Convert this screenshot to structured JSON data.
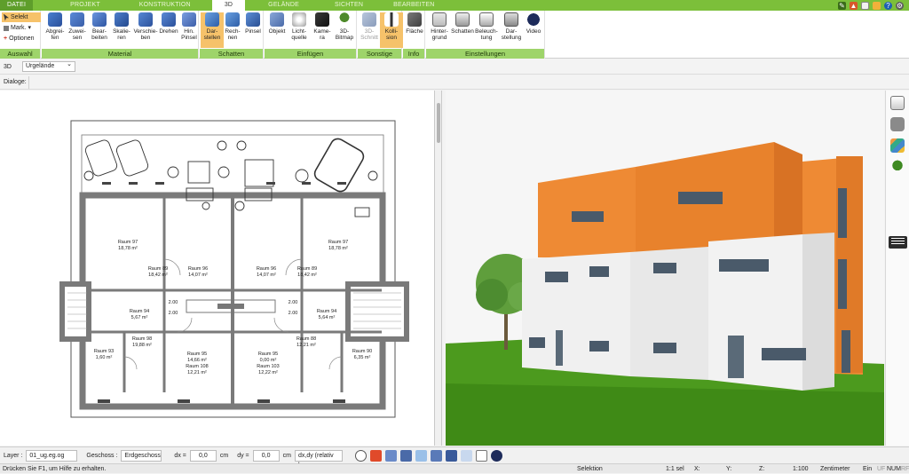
{
  "tabs": [
    {
      "label": "DATEI"
    },
    {
      "label": "PROJEKT"
    },
    {
      "label": "KONSTRUKTION"
    },
    {
      "label": "3D"
    },
    {
      "label": "GELÄNDE"
    },
    {
      "label": "SICHTEN"
    },
    {
      "label": "BEARBEITEN"
    }
  ],
  "active_tab": "3D",
  "ribbon": {
    "auswahl": {
      "caption": "Auswahl",
      "selekt": "Selekt",
      "mark": "Mark.",
      "optionen": "Optionen"
    },
    "material": {
      "caption": "Material",
      "buttons": [
        "Abgrei-\nfen",
        "Zuwei-\nsen",
        "Bear-\nbeiten",
        "Skalie-\nren",
        "Verschie-\nben",
        "Drehen",
        "Hin.\nPinsel"
      ]
    },
    "schatten": {
      "caption": "Schatten",
      "buttons": [
        "Dar-\nstellen",
        "Rech-\nnen",
        "Pinsel"
      ]
    },
    "einfuegen": {
      "caption": "Einfügen",
      "buttons": [
        "Objekt",
        "Licht-\nquelle",
        "Kame-\nra",
        "3D-\nBitmap"
      ]
    },
    "sonstige": {
      "caption": "Sonstige",
      "buttons": [
        "3D-\nSchnitt",
        "Kolli-\nsion"
      ]
    },
    "info": {
      "caption": "Info",
      "buttons": [
        "Fläche"
      ]
    },
    "einstellungen": {
      "caption": "Einstellungen",
      "buttons": [
        "Hinter-\ngrund",
        "Schatten",
        "Beleuch-\ntung",
        "Dar-\nstellung",
        "Video"
      ]
    }
  },
  "viewbar": {
    "mode": "3D",
    "terrain": "Urgelände"
  },
  "dialoge_label": "Dialoge:",
  "plan": {
    "rooms": [
      {
        "name": "Raum 97",
        "area": "18,78 m²"
      },
      {
        "name": "Raum 97",
        "area": "18,78 m²"
      },
      {
        "name": "Raum 96",
        "area": "14,07 m²"
      },
      {
        "name": "Raum 96",
        "area": "14,07 m²"
      },
      {
        "name": "Raum 89",
        "area": "18,42 m²"
      },
      {
        "name": "Raum 89",
        "area": "18,42 m²"
      },
      {
        "name": "Raum 94",
        "area": "5,67 m²"
      },
      {
        "name": "Raum 94",
        "area": "5,64 m²"
      },
      {
        "name": "Raum 95",
        "area": "14,66 m²"
      },
      {
        "name": "Raum 95",
        "area": "0,00 m²"
      },
      {
        "name": "Raum 108",
        "area": "12,21 m²"
      },
      {
        "name": "Raum 103",
        "area": "12,22 m²"
      },
      {
        "name": "Raum 93",
        "area": "1,60 m²"
      },
      {
        "name": "Raum 90",
        "area": "6,35 m²"
      },
      {
        "name": "Raum 98",
        "area": "19,88 m²"
      },
      {
        "name": "Raum 88",
        "area": "12,21 m²"
      }
    ],
    "dims": [
      "2.00",
      "2.00",
      "2.00",
      "2.00"
    ]
  },
  "inputbar": {
    "layer_label": "Layer :",
    "layer_value": "01_ug.eg.og",
    "geschoss_label": "Geschoss :",
    "geschoss_value": "Erdgeschoss",
    "dx_label": "dx =",
    "dx_value": "0,0",
    "dx_unit": "cm",
    "dy_label": "dy =",
    "dy_value": "0,0",
    "dy_unit": "cm",
    "mode_value": "dx,dy (relativ ka"
  },
  "statusbar": {
    "hint": "Drücken Sie F1, um Hilfe zu erhalten.",
    "mode": "Selektion",
    "sel": "1:1 sel",
    "x": "X:",
    "y": "Y:",
    "z": "Z:",
    "scale": "1:100",
    "unit": "Zentimeter",
    "ein": "Ein",
    "uf": "UF",
    "num": "NUM",
    "rf": "RF"
  },
  "colors": {
    "tab_green": "#7cbf3a",
    "caption_green": "#9ed46a",
    "highlight": "#f6c26a",
    "facade_orange": "#ee8a34",
    "facade_white": "#f1f1f1",
    "lawn": "#4c9a1e",
    "sky": "#f6f6f6"
  }
}
